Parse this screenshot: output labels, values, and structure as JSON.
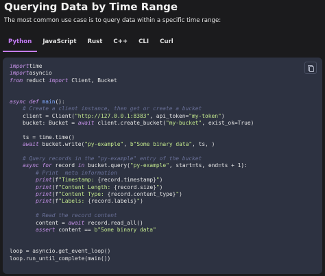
{
  "header": {
    "title": "Querying Data by Time Range",
    "subtitle": "The most common use case is to query data within a specific time range:"
  },
  "tabs": [
    {
      "label": "Python",
      "active": true
    },
    {
      "label": "JavaScript",
      "active": false
    },
    {
      "label": "Rust",
      "active": false
    },
    {
      "label": "C++",
      "active": false
    },
    {
      "label": "CLI",
      "active": false
    },
    {
      "label": "Curl",
      "active": false
    }
  ],
  "code_block": {
    "language": "python",
    "copy_icon": "copy-icon",
    "lines": [
      [
        [
          "kw",
          "import"
        ],
        [
          "",
          "time"
        ]
      ],
      [
        [
          "kw",
          "import"
        ],
        [
          "",
          "asyncio"
        ]
      ],
      [
        [
          "kw",
          "from"
        ],
        [
          "",
          " reduct "
        ],
        [
          "kw",
          "import"
        ],
        [
          "",
          " Client, Bucket"
        ]
      ],
      [],
      [],
      [
        [
          "kw",
          "async def"
        ],
        [
          "",
          " "
        ],
        [
          "fn",
          "main"
        ],
        [
          "",
          "():"
        ]
      ],
      [
        [
          "cm",
          "    # Create a client instance, then get or create a bucket"
        ]
      ],
      [
        [
          "",
          "    client = Client("
        ],
        [
          "str",
          "\"http://127.0.0.1:8383\""
        ],
        [
          "",
          ", api_token="
        ],
        [
          "str",
          "\"my-token\""
        ],
        [
          "",
          ")"
        ]
      ],
      [
        [
          "",
          "    bucket: Bucket = "
        ],
        [
          "kw",
          "await"
        ],
        [
          "",
          " client.create_bucket("
        ],
        [
          "str",
          "\"my-bucket\""
        ],
        [
          "",
          ", exist_ok=True)"
        ]
      ],
      [],
      [
        [
          "",
          "    ts = time.time()"
        ]
      ],
      [
        [
          "",
          "    "
        ],
        [
          "kw",
          "await"
        ],
        [
          "",
          " bucket.write("
        ],
        [
          "str",
          "\"py-example\""
        ],
        [
          "",
          ", "
        ],
        [
          "str",
          "b\"Some binary data\""
        ],
        [
          "",
          ", ts, )"
        ]
      ],
      [],
      [
        [
          "cm",
          "    # Query records in the \"py-example\" entry of the bucket"
        ]
      ],
      [
        [
          "",
          "    "
        ],
        [
          "kw",
          "async for"
        ],
        [
          "",
          " record "
        ],
        [
          "kw",
          "in"
        ],
        [
          "",
          " bucket.query("
        ],
        [
          "str",
          "\"py-example\""
        ],
        [
          "",
          ", start=ts, end=ts + 1):"
        ]
      ],
      [
        [
          "cm",
          "        # Print  meta information"
        ]
      ],
      [
        [
          "",
          "        "
        ],
        [
          "kw",
          "print"
        ],
        [
          "",
          "(f"
        ],
        [
          "str",
          "\"Timestamp: "
        ],
        [
          "",
          "{record.timestamp}"
        ],
        [
          "str",
          "\""
        ],
        [
          "",
          ")"
        ]
      ],
      [
        [
          "",
          "        "
        ],
        [
          "kw",
          "print"
        ],
        [
          "",
          "(f"
        ],
        [
          "str",
          "\"Content Length: "
        ],
        [
          "",
          "{record.size}"
        ],
        [
          "str",
          "\""
        ],
        [
          "",
          ")"
        ]
      ],
      [
        [
          "",
          "        "
        ],
        [
          "kw",
          "print"
        ],
        [
          "",
          "(f"
        ],
        [
          "str",
          "\"Content Type: "
        ],
        [
          "",
          "{record.content_type}"
        ],
        [
          "str",
          "\""
        ],
        [
          "",
          ")"
        ]
      ],
      [
        [
          "",
          "        "
        ],
        [
          "kw",
          "print"
        ],
        [
          "",
          "(f"
        ],
        [
          "str",
          "\"Labels: "
        ],
        [
          "",
          "{record.labels}"
        ],
        [
          "str",
          "\""
        ],
        [
          "",
          ")"
        ]
      ],
      [],
      [
        [
          "cm",
          "        # Read the record content"
        ]
      ],
      [
        [
          "",
          "        content = "
        ],
        [
          "kw",
          "await"
        ],
        [
          "",
          " record.read_all()"
        ]
      ],
      [
        [
          "",
          "        "
        ],
        [
          "kw",
          "assert"
        ],
        [
          "",
          " content == "
        ],
        [
          "str",
          "b\"Some binary data\""
        ]
      ],
      [],
      [],
      [
        [
          "",
          "loop = asyncio.get_event_loop()"
        ]
      ],
      [
        [
          "",
          "loop.run_until_complete(main())"
        ]
      ]
    ]
  }
}
